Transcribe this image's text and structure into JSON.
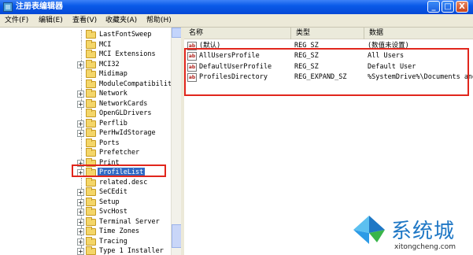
{
  "window": {
    "title": "注册表编辑器",
    "minimize": "_",
    "maximize": "□",
    "close": "X"
  },
  "menu": [
    "文件(F)",
    "编辑(E)",
    "查看(V)",
    "收藏夹(A)",
    "帮助(H)"
  ],
  "tree": {
    "items": [
      {
        "label": "LastFontSweep",
        "expandable": false
      },
      {
        "label": "MCI",
        "expandable": false
      },
      {
        "label": "MCI Extensions",
        "expandable": false
      },
      {
        "label": "MCI32",
        "expandable": true
      },
      {
        "label": "Midimap",
        "expandable": false
      },
      {
        "label": "ModuleCompatibility",
        "expandable": false
      },
      {
        "label": "Network",
        "expandable": true
      },
      {
        "label": "NetworkCards",
        "expandable": true
      },
      {
        "label": "OpenGLDrivers",
        "expandable": false
      },
      {
        "label": "Perflib",
        "expandable": true
      },
      {
        "label": "PerHwIdStorage",
        "expandable": true
      },
      {
        "label": "Ports",
        "expandable": false
      },
      {
        "label": "Prefetcher",
        "expandable": false
      },
      {
        "label": "Print",
        "expandable": true
      },
      {
        "label": "ProfileList",
        "expandable": true,
        "selected": true
      },
      {
        "label": "related.desc",
        "expandable": false
      },
      {
        "label": "SeCEdit",
        "expandable": true
      },
      {
        "label": "Setup",
        "expandable": true
      },
      {
        "label": "SvcHost",
        "expandable": true
      },
      {
        "label": "Terminal Server",
        "expandable": true
      },
      {
        "label": "Time Zones",
        "expandable": true
      },
      {
        "label": "Tracing",
        "expandable": true
      },
      {
        "label": "Type 1 Installer",
        "expandable": true
      }
    ],
    "expander_symbol": "+"
  },
  "list": {
    "columns": [
      "名称",
      "类型",
      "数据"
    ],
    "rows": [
      {
        "name": "(默认)",
        "type": "REG_SZ",
        "data": "(数值未设置)"
      },
      {
        "name": "AllUsersProfile",
        "type": "REG_SZ",
        "data": "All Users"
      },
      {
        "name": "DefaultUserProfile",
        "type": "REG_SZ",
        "data": "Default User"
      },
      {
        "name": "ProfilesDirectory",
        "type": "REG_EXPAND_SZ",
        "data": "%SystemDrive%\\Documents and"
      }
    ],
    "value_icon_text": "ab"
  },
  "watermark": {
    "brand": "系统城",
    "url": "xitongcheng.com"
  },
  "colors": {
    "highlight": "#e1261c",
    "selection": "#316ac5",
    "titlebar": "#0a5ae8"
  }
}
